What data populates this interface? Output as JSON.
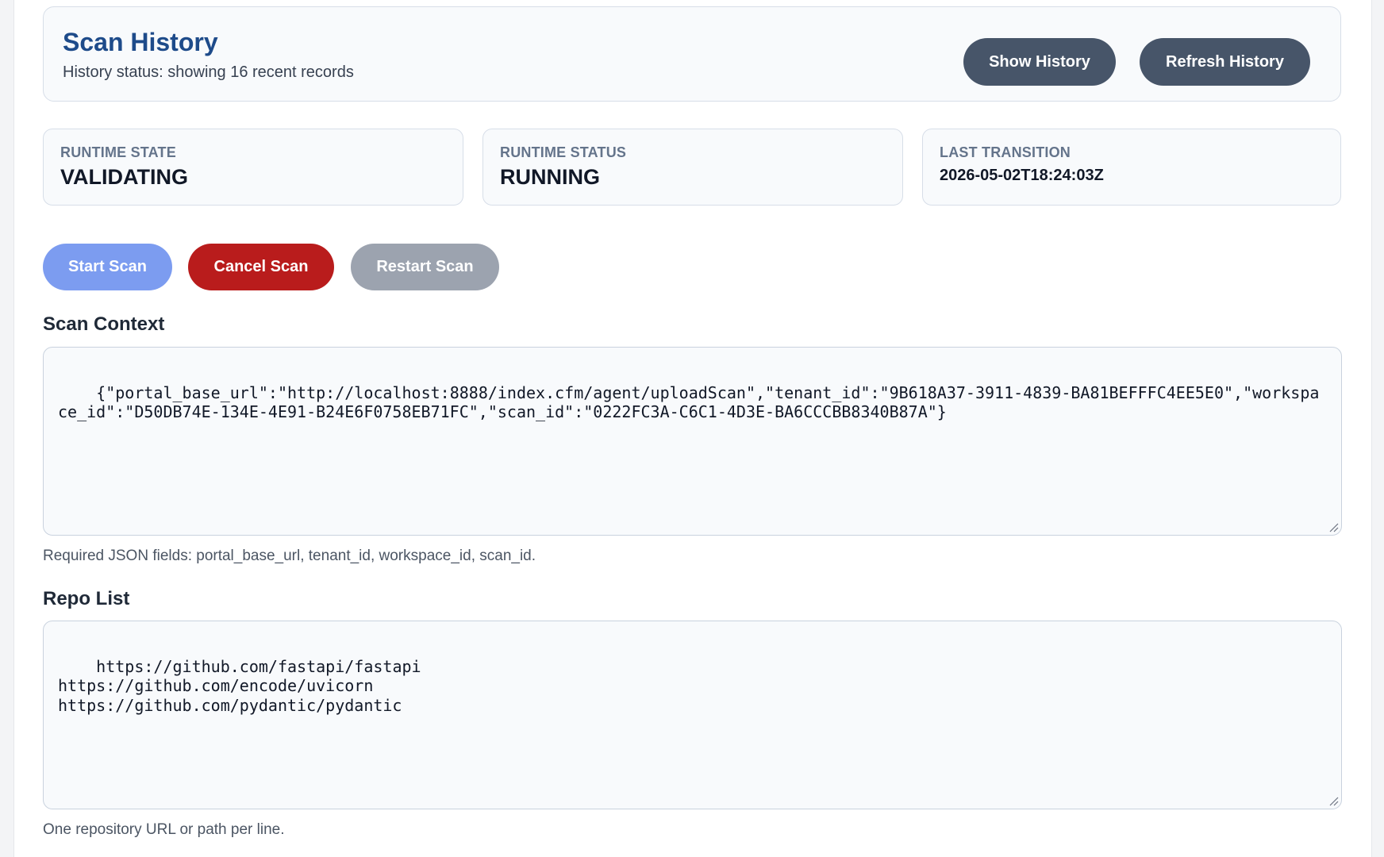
{
  "history": {
    "title": "Scan History",
    "status": "History status: showing 16 recent records",
    "show_button": "Show History",
    "refresh_button": "Refresh History"
  },
  "stats": [
    {
      "label": "RUNTIME STATE",
      "value": "VALIDATING"
    },
    {
      "label": "RUNTIME STATUS",
      "value": "RUNNING"
    },
    {
      "label": "LAST TRANSITION",
      "value": "2026-05-02T18:24:03Z"
    }
  ],
  "actions": {
    "start": "Start Scan",
    "cancel": "Cancel Scan",
    "restart": "Restart Scan"
  },
  "scan_context": {
    "label": "Scan Context",
    "value": "{\"portal_base_url\":\"http://localhost:8888/index.cfm/agent/uploadScan\",\"tenant_id\":\"9B618A37-3911-4839-BA81BEFFFC4EE5E0\",\"workspace_id\":\"D50DB74E-134E-4E91-B24E6F0758EB71FC\",\"scan_id\":\"0222FC3A-C6C1-4D3E-BA6CCCBB8340B87A\"}",
    "hint": "Required JSON fields: portal_base_url, tenant_id, workspace_id, scan_id."
  },
  "repo_list": {
    "label": "Repo List",
    "value": "https://github.com/fastapi/fastapi\nhttps://github.com/encode/uvicorn\nhttps://github.com/pydantic/pydantic",
    "hint": "One repository URL or path per line."
  },
  "colors": {
    "title_blue": "#1e4b8a",
    "dark_button": "#475569",
    "start_button": "#7c9cf0",
    "cancel_button": "#b91c1c",
    "restart_button": "#9ca3af"
  }
}
